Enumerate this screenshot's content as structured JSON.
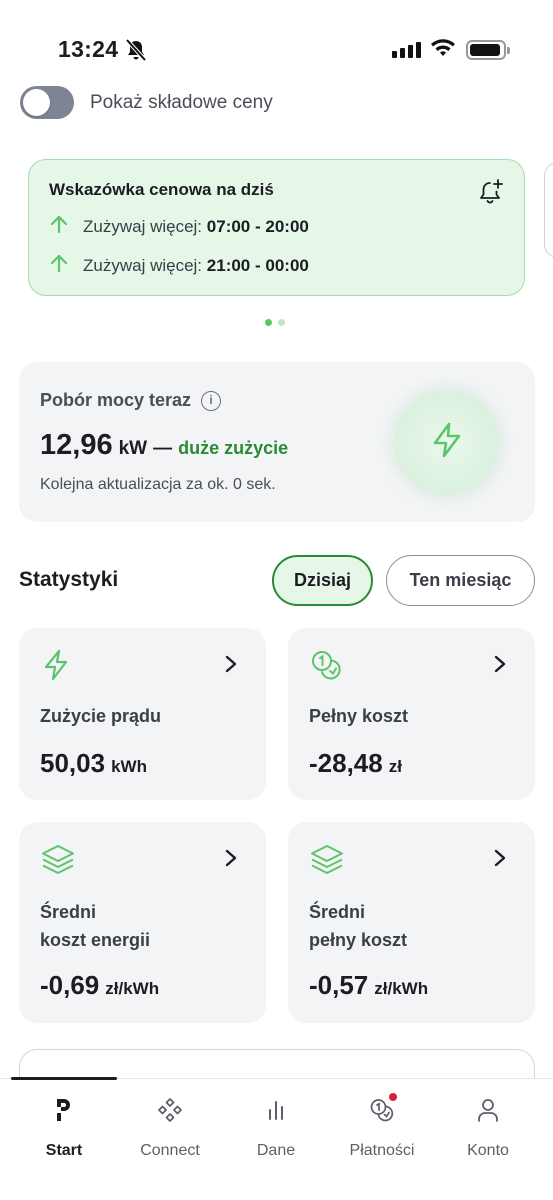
{
  "status_bar": {
    "time": "13:24"
  },
  "toggle": {
    "label": "Pokaż składowe ceny",
    "on": false
  },
  "price_hint": {
    "title": "Wskazówka cenowa na dziś",
    "rows": [
      {
        "prefix": "Zużywaj więcej:",
        "range": "07:00 - 20:00"
      },
      {
        "prefix": "Zużywaj więcej:",
        "range": "21:00 - 00:00"
      }
    ]
  },
  "carousel": {
    "pages": 2,
    "active_page": 1
  },
  "power": {
    "title": "Pobór mocy teraz",
    "value": "12,96",
    "unit": "kW",
    "dash": "—",
    "status": "duże zużycie",
    "subtitle": "Kolejna aktualizacja za ok. 0 sek."
  },
  "stats": {
    "title": "Statystyki",
    "chips": {
      "today": "Dzisiaj",
      "month": "Ten miesiąc"
    },
    "tiles": [
      {
        "label_line1": "Zużycie prądu",
        "label_line2": "",
        "value": "50,03",
        "unit": "kWh",
        "icon": "bolt-icon"
      },
      {
        "label_line1": "Pełny koszt",
        "label_line2": "",
        "value": "-28,48",
        "unit": "zł",
        "icon": "coins-icon"
      },
      {
        "label_line1": "Średni",
        "label_line2": "koszt energii",
        "value": "-0,69",
        "unit": "zł/kWh",
        "icon": "layers-icon"
      },
      {
        "label_line1": "Średni",
        "label_line2": "pełny koszt",
        "value": "-0,57",
        "unit": "zł/kWh",
        "icon": "layers-icon"
      }
    ]
  },
  "tabs": {
    "start": "Start",
    "connect": "Connect",
    "data": "Dane",
    "payments": "Płatności",
    "account": "Konto"
  },
  "colors": {
    "accent_green": "#2a8a35",
    "icon_green": "#5cc46a",
    "notification_red": "#d6213a"
  }
}
